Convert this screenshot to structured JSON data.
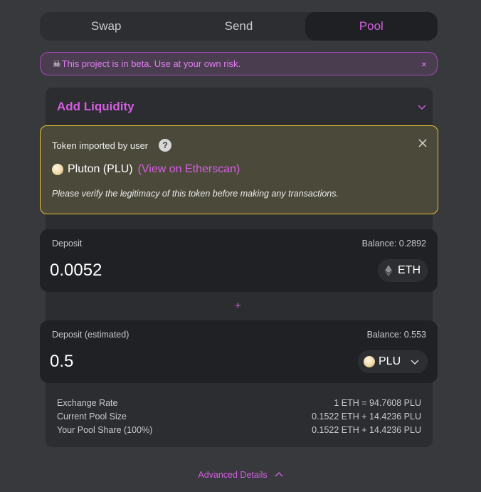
{
  "tabs": [
    {
      "label": "Swap",
      "active": false
    },
    {
      "label": "Send",
      "active": false
    },
    {
      "label": "Pool",
      "active": true
    }
  ],
  "banner": {
    "icon": "skull-icon",
    "text": "This project is in beta. Use at your own risk.",
    "close_label": "×"
  },
  "card": {
    "title": "Add Liquidity",
    "toggle_icon": "chevron-down-icon"
  },
  "token_warning": {
    "heading": "Token imported by user",
    "help_label": "?",
    "token_name": "Pluton (PLU)",
    "link_text": "(View on Etherscan)",
    "message": "Please verify the legitimacy of this token before making any transactions."
  },
  "deposit_1": {
    "label": "Deposit",
    "balance": "Balance: 0.2892",
    "amount": "0.0052",
    "token": "ETH"
  },
  "plus": "+",
  "deposit_2": {
    "label": "Deposit (estimated)",
    "balance": "Balance: 0.553",
    "amount": "0.5",
    "token": "PLU"
  },
  "info": [
    {
      "label": "Exchange Rate",
      "value": "1 ETH = 94.7608 PLU"
    },
    {
      "label": "Current Pool Size",
      "value": "0.1522 ETH + 14.4236 PLU"
    },
    {
      "label": "Your Pool Share (100%)",
      "value": "0.1522 ETH + 14.4236 PLU"
    }
  ],
  "advanced": {
    "label": "Advanced Details"
  },
  "colors": {
    "accent": "#d55ee3",
    "warning_border": "#e8c12a",
    "background": "#37393c"
  }
}
